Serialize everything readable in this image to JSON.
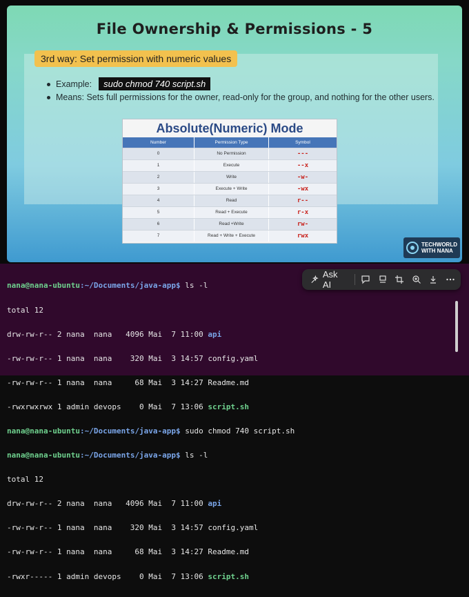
{
  "slide": {
    "title": "File Ownership & Permissions - 5",
    "way_label": "3rd way: Set permission with numeric values",
    "bullets": {
      "example_label": "Example:",
      "example_code": "sudo chmod 740 script.sh",
      "means": "Means: Sets full permissions for the owner, read-only for the group, and nothing for the other users."
    },
    "table": {
      "title": "Absolute(Numeric) Mode",
      "headers": [
        "Number",
        "Permission Type",
        "Symbol"
      ],
      "rows": [
        [
          "0",
          "No Permission",
          "---"
        ],
        [
          "1",
          "Execute",
          "--x"
        ],
        [
          "2",
          "Write",
          "-w-"
        ],
        [
          "3",
          "Execute + Write",
          "-wx"
        ],
        [
          "4",
          "Read",
          "r--"
        ],
        [
          "5",
          "Read + Execute",
          "r-x"
        ],
        [
          "6",
          "Read +Write",
          "rw-"
        ],
        [
          "7",
          "Read + Write + Execute",
          "rwx"
        ]
      ]
    },
    "logo": {
      "line1": "TECHWORLD",
      "line2": "WITH NANA"
    }
  },
  "terminal": {
    "prompt_user": "nana@nana-ubuntu",
    "prompt_path": ":~/Documents/java-app$",
    "cmd1": " ls -l",
    "cmd2": " sudo chmod 740 script.sh",
    "cmd3": " ls -l",
    "total": "total 12",
    "listing1": [
      {
        "meta": "drw-rw-r-- 2 nana  nana   4096 Mai  7 11:00 ",
        "name": "api",
        "kind": "dir"
      },
      {
        "meta": "-rw-rw-r-- 1 nana  nana    320 Mai  3 14:57 ",
        "name": "config.yaml",
        "kind": "file"
      },
      {
        "meta": "-rw-rw-r-- 1 nana  nana     68 Mai  3 14:27 ",
        "name": "Readme.md",
        "kind": "file"
      },
      {
        "meta": "-rwxrwxrwx 1 admin devops    0 Mai  7 13:06 ",
        "name": "script.sh",
        "kind": "exe"
      }
    ],
    "listing2": [
      {
        "meta": "drw-rw-r-- 2 nana  nana   4096 Mai  7 11:00 ",
        "name": "api",
        "kind": "dir"
      },
      {
        "meta": "-rw-rw-r-- 1 nana  nana    320 Mai  3 14:57 ",
        "name": "config.yaml",
        "kind": "file"
      },
      {
        "meta": "-rw-rw-r-- 1 nana  nana     68 Mai  3 14:27 ",
        "name": "Readme.md",
        "kind": "file"
      },
      {
        "meta": "-rwxr----- 1 admin devops    0 Mai  7 13:06 ",
        "name": "script.sh",
        "kind": "exe"
      }
    ]
  },
  "toolbar": {
    "ask_ai": "Ask AI",
    "icons": [
      "sparkle-icon",
      "comment-icon",
      "copy-icon",
      "crop-icon",
      "zoom-icon",
      "download-icon",
      "more-icon"
    ]
  },
  "colors": {
    "highlight": "#f2c14e",
    "terminal_bg": "#30092c",
    "symbol_red": "#c8211b",
    "table_header": "#4675b8"
  }
}
